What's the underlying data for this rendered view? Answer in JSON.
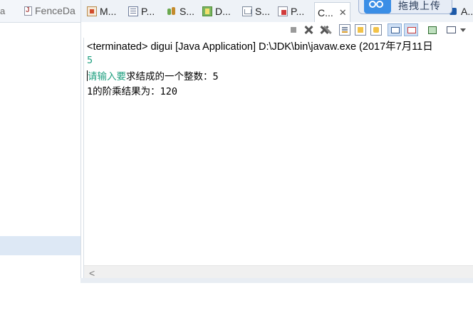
{
  "editor": {
    "tab_stub": "a",
    "tab_label": "FenceDa"
  },
  "view_tabs": [
    {
      "label": "M...",
      "icon": "markers-icon"
    },
    {
      "label": "P...",
      "icon": "properties-icon"
    },
    {
      "label": "S...",
      "icon": "servers-icon"
    },
    {
      "label": "D...",
      "icon": "data-source-icon"
    },
    {
      "label": "S...",
      "icon": "snippets-icon"
    },
    {
      "label": "P...",
      "icon": "problems-icon"
    },
    {
      "label": "C...",
      "icon": "console-icon",
      "active": true
    },
    {
      "label": "A...",
      "icon": "ant-icon"
    }
  ],
  "upload_badge": {
    "label": "拖拽上传"
  },
  "console": {
    "status": "<terminated> digui [Java Application] D:\\JDK\\bin\\javaw.exe (2017年7月11日",
    "input_echo": "5",
    "prompt_green": "请输入要",
    "prompt_black": "求结成的一个整数：5",
    "result": "1的阶乘结果为：120"
  },
  "scrollbar": {
    "left_arrow": "<"
  },
  "colors": {
    "console_input": "#20a080",
    "tab_bar": "#eef2f7",
    "selection": "#dde8f5"
  }
}
